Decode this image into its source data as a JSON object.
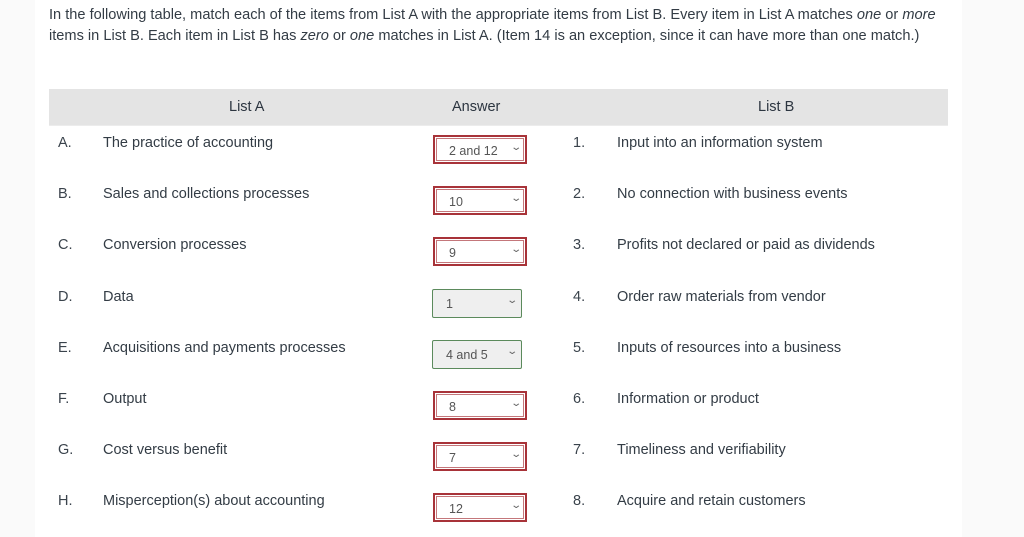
{
  "instructions": {
    "part1": "In the following table, match each of the items from List A with the appropriate items from List B. Every item in List A matches ",
    "em1": "one",
    "part2": " or ",
    "em2": "more",
    "part3": " items in List B. Each item in List B has ",
    "em3": "zero",
    "part4": " or ",
    "em4": "one",
    "part5": " matches in List A. (Item 14 is an exception, since it can have more than one match.)"
  },
  "table": {
    "headers": {
      "list_a": "List A",
      "answer": "Answer",
      "list_b": "List B"
    },
    "rows": [
      {
        "letter": "A.",
        "list_a": "The practice of accounting",
        "answer": "2 and 12",
        "status": "wrong",
        "number": "1.",
        "list_b": "Input into an information system"
      },
      {
        "letter": "B.",
        "list_a": "Sales and collections processes",
        "answer": "10",
        "status": "wrong",
        "number": "2.",
        "list_b": "No connection with business events"
      },
      {
        "letter": "C.",
        "list_a": "Conversion processes",
        "answer": "9",
        "status": "wrong",
        "number": "3.",
        "list_b": "Profits not declared or paid as dividends"
      },
      {
        "letter": "D.",
        "list_a": "Data",
        "answer": "1",
        "status": "correct",
        "number": "4.",
        "list_b": "Order raw materials from vendor"
      },
      {
        "letter": "E.",
        "list_a": "Acquisitions and payments processes",
        "answer": "4 and 5",
        "status": "correct",
        "number": "5.",
        "list_b": "Inputs of resources into a business"
      },
      {
        "letter": "F.",
        "list_a": "Output",
        "answer": "8",
        "status": "wrong",
        "number": "6.",
        "list_b": "Information or product"
      },
      {
        "letter": "G.",
        "list_a": "Cost versus benefit",
        "answer": "7",
        "status": "wrong",
        "number": "7.",
        "list_b": "Timeliness and verifiability"
      },
      {
        "letter": "H.",
        "list_a": "Misperception(s) about accounting",
        "answer": "12",
        "status": "wrong",
        "number": "8.",
        "list_b": "Acquire and retain customers"
      }
    ]
  },
  "icons": {
    "dropdown": "chevron-down-icon"
  },
  "colors": {
    "wrong_border": "#a83339",
    "correct_border": "#5b8a5c",
    "header_bg": "#e4e4e4"
  }
}
